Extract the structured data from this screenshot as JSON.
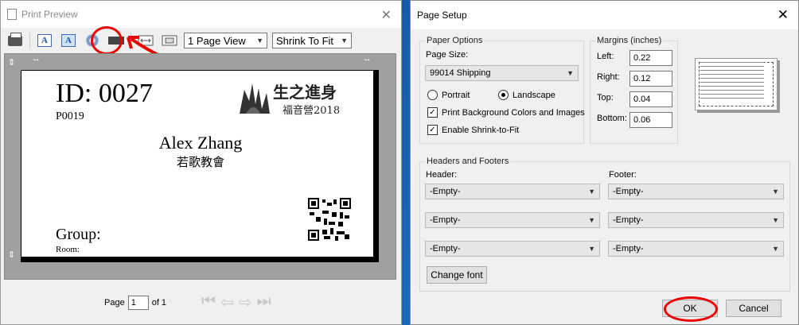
{
  "print_preview": {
    "title": "Print Preview",
    "view_select": "1 Page View",
    "fit_select": "Shrink To Fit",
    "card": {
      "id": "ID: 0027",
      "code": "P0019",
      "name": "Alex Zhang",
      "church": "若歌教會",
      "group": "Group:",
      "room": "Room:",
      "logo_text": "生之進身",
      "logo_sub": "福音營2018"
    },
    "footer": {
      "page_label": "Page",
      "page_value": "1",
      "of_label": "of 1"
    }
  },
  "page_setup": {
    "title": "Page Setup",
    "paper_options_label": "Paper Options",
    "page_size_label": "Page Size:",
    "page_size_value": "99014 Shipping",
    "portrait_label": "Portrait",
    "landscape_label": "Landscape",
    "orientation": "Landscape",
    "print_bg_label": "Print Background Colors and Images",
    "print_bg_checked": true,
    "shrink_label": "Enable Shrink-to-Fit",
    "shrink_checked": true,
    "margins_label": "Margins (inches)",
    "left_label": "Left:",
    "left_value": "0.22",
    "right_label": "Right:",
    "right_value": "0.12",
    "top_label": "Top:",
    "top_value": "0.04",
    "bottom_label": "Bottom:",
    "bottom_value": "0.06",
    "hf_label": "Headers and Footers",
    "header_label": "Header:",
    "footer_label": "Footer:",
    "header_values": [
      "-Empty-",
      "-Empty-",
      "-Empty-"
    ],
    "footer_values": [
      "-Empty-",
      "-Empty-",
      "-Empty-"
    ],
    "change_font": "Change font",
    "ok": "OK",
    "cancel": "Cancel"
  },
  "colors": {
    "annotation": "#e00000",
    "desktop": "#1a66b8"
  }
}
